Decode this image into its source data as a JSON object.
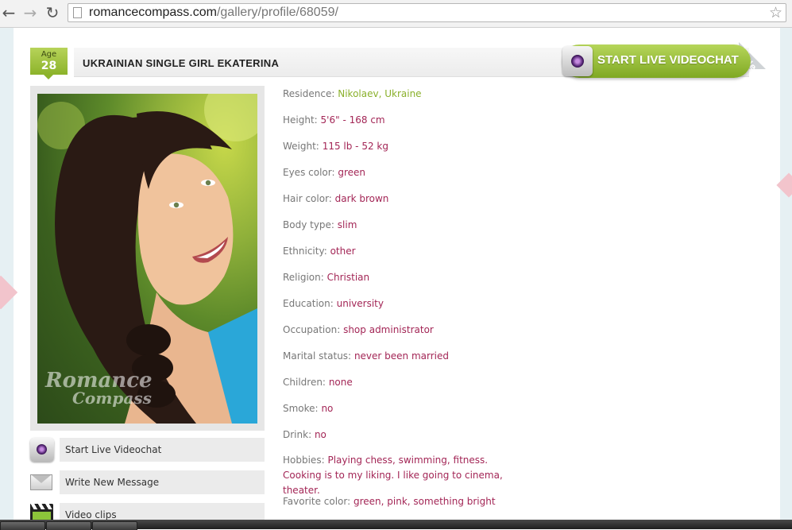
{
  "browser": {
    "back_icon": "back-arrow-icon",
    "forward_icon": "forward-arrow-icon",
    "reload_icon": "reload-icon",
    "url_host": "romancecompass.com",
    "url_path": "/gallery/profile/68059/",
    "bookmark_icon": "star-icon"
  },
  "header": {
    "age_label": "Age",
    "age_value": "28",
    "title": "UKRAINIAN SINGLE GIRL EKATERINA",
    "videochat_banner": "START LIVE VIDEOCHAT",
    "corner_ribbon": "ile"
  },
  "photo": {
    "watermark_line1": "Romance",
    "watermark_line2": "Compass"
  },
  "actions": [
    {
      "label": "Start Live Videochat",
      "icon": "webcam-icon"
    },
    {
      "label": "Write New Message",
      "icon": "envelope-icon"
    },
    {
      "label": "Video clips",
      "icon": "clapperboard-icon"
    }
  ],
  "profile": {
    "residence": {
      "label": "Residence:",
      "value": "Nikolaev, Ukraine"
    },
    "height": {
      "label": "Height:",
      "value": "5'6\" - 168 cm"
    },
    "weight": {
      "label": "Weight:",
      "value": "115 lb - 52 kg"
    },
    "eyes": {
      "label": "Eyes color:",
      "value": "green"
    },
    "hair": {
      "label": "Hair color:",
      "value": "dark brown"
    },
    "body": {
      "label": "Body type:",
      "value": "slim"
    },
    "ethnicity": {
      "label": "Ethnicity:",
      "value": "other"
    },
    "religion": {
      "label": "Religion:",
      "value": "Christian"
    },
    "education": {
      "label": "Education:",
      "value": "university"
    },
    "occupation": {
      "label": "Occupation:",
      "value": "shop administrator"
    },
    "marital": {
      "label": "Marital status:",
      "value": "never been married"
    },
    "children": {
      "label": "Children:",
      "value": "none"
    },
    "smoke": {
      "label": "Smoke:",
      "value": "no"
    },
    "drink": {
      "label": "Drink:",
      "value": "no"
    },
    "hobbies": {
      "label": "Hobbies:",
      "value": "Playing chess, swimming, fitness. Cooking is to my liking. I like going to cinema, theater."
    },
    "favorite_color": {
      "label": "Favorite color:",
      "value": "green, pink, something bright"
    }
  },
  "colors": {
    "value_text": "#a32656",
    "residence_value": "#8ab02b",
    "label_text": "#777777",
    "accent_green": "#8cb32a"
  }
}
